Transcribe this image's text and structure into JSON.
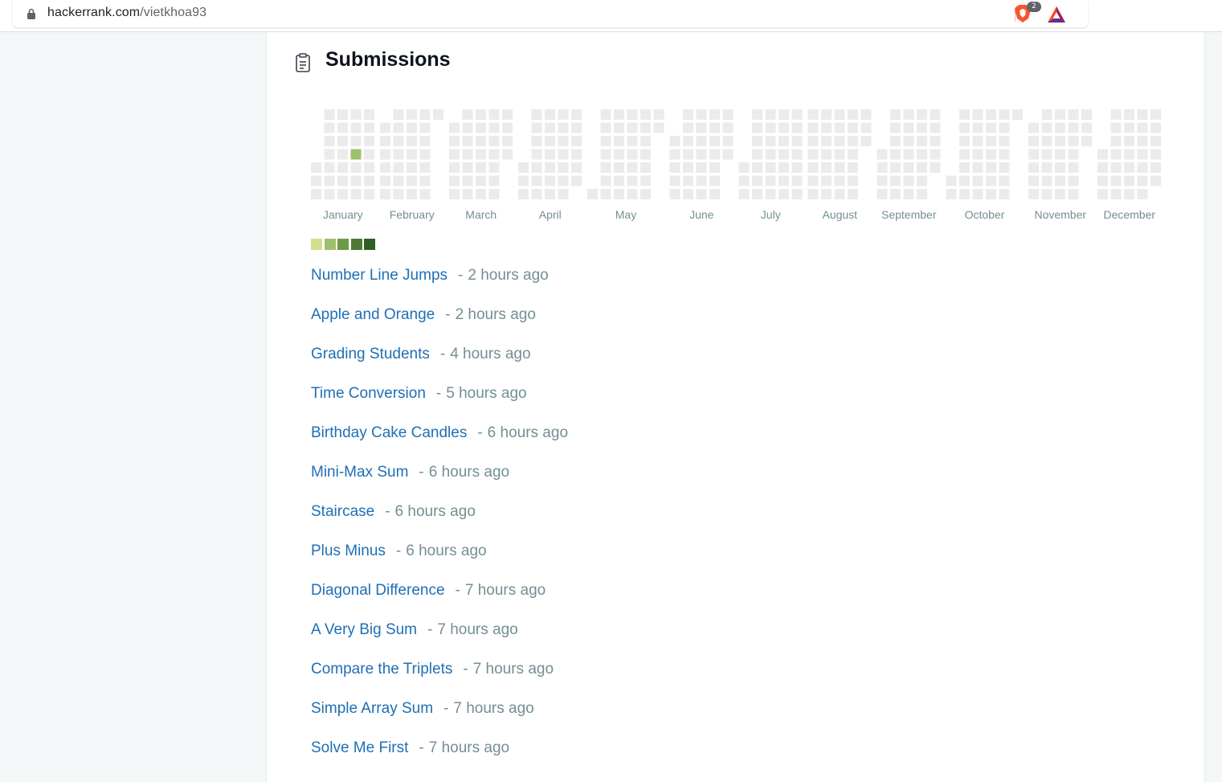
{
  "browser": {
    "url_host": "hackerrank.com",
    "url_path": "/vietkhoa93",
    "brave_badge_count": "2"
  },
  "section": {
    "title": "Submissions"
  },
  "heatmap": {
    "months": [
      "January",
      "February",
      "March",
      "April",
      "May",
      "June",
      "July",
      "August",
      "September",
      "October",
      "November",
      "December"
    ],
    "colors": {
      "empty": "#ebebeb",
      "level1": "#d2e08e",
      "level2": "#9ebf6b",
      "level3": "#6e9a45",
      "level4": "#4f7a33",
      "level5": "#2f5f22"
    },
    "active_days": [
      {
        "month": "January",
        "week": 3,
        "weekday": 3,
        "level": 2
      }
    ]
  },
  "legend_levels": [
    "level1",
    "level2",
    "level3",
    "level4",
    "level5"
  ],
  "submissions": [
    {
      "name": "Number Line Jumps",
      "time": "2 hours ago"
    },
    {
      "name": "Apple and Orange",
      "time": "2 hours ago"
    },
    {
      "name": "Grading Students",
      "time": "4 hours ago"
    },
    {
      "name": "Time Conversion",
      "time": "5 hours ago"
    },
    {
      "name": "Birthday Cake Candles",
      "time": "6 hours ago"
    },
    {
      "name": "Mini-Max Sum",
      "time": "6 hours ago"
    },
    {
      "name": "Staircase",
      "time": "6 hours ago"
    },
    {
      "name": "Plus Minus",
      "time": "6 hours ago"
    },
    {
      "name": "Diagonal Difference",
      "time": "7 hours ago"
    },
    {
      "name": "A Very Big Sum",
      "time": "7 hours ago"
    },
    {
      "name": "Compare the Triplets",
      "time": "7 hours ago"
    },
    {
      "name": "Simple Array Sum",
      "time": "7 hours ago"
    },
    {
      "name": "Solve Me First",
      "time": "7 hours ago"
    }
  ],
  "dash": "-"
}
